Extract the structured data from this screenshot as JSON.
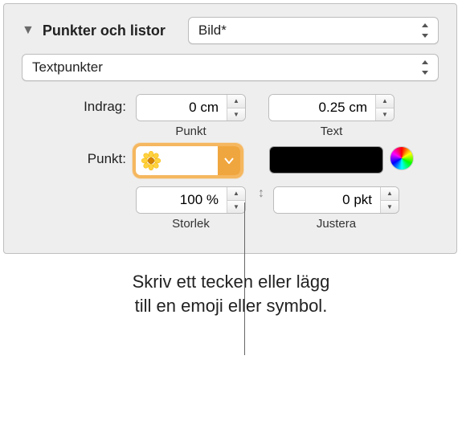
{
  "section": {
    "title": "Punkter och listor"
  },
  "style_popup": {
    "value": "Bild*"
  },
  "type_popup": {
    "value": "Textpunkter"
  },
  "indent": {
    "label": "Indrag:",
    "bullet_value": "0 cm",
    "bullet_sub": "Punkt",
    "text_value": "0.25 cm",
    "text_sub": "Text"
  },
  "bullet": {
    "label": "Punkt:",
    "symbol": "🌼"
  },
  "size": {
    "value": "100 %",
    "sub": "Storlek"
  },
  "align": {
    "value": "0 pkt",
    "sub": "Justera"
  },
  "caption": {
    "line1": "Skriv ett tecken eller lägg",
    "line2": "till en emoji eller symbol."
  }
}
